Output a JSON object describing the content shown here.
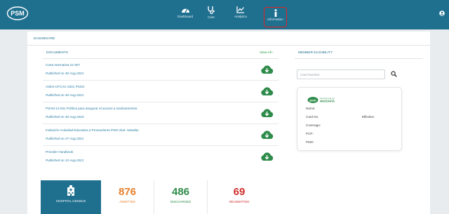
{
  "header": {
    "logo_text": "PSM",
    "logo_subtext": "",
    "nav": [
      {
        "label": "Dashboard",
        "icon": "gauge-icon"
      },
      {
        "label": "Care",
        "icon": "stethoscope-icon"
      },
      {
        "label": "Analytics",
        "icon": "line-chart-icon"
      },
      {
        "label": "Information",
        "icon": "info-icon",
        "highlighted": true
      }
    ]
  },
  "dashboard": {
    "title": "DASHBOARD"
  },
  "documents": {
    "title": "DOCUMENTS",
    "view_all": "View All",
    "items": [
      {
        "title": "Carta Normativa 21-007",
        "date": "Published on 30-Aug-2021"
      },
      {
        "title": "ASES-CFCAC-2021 PSSO",
        "date": "Published on 30-Aug-2021"
      },
      {
        "title": "PSAM 21-031 Política para asegurar el acceso a medicamentos",
        "date": "Published on 30-Aug-2020"
      },
      {
        "title": "Invitación Actividad Educativa a Proveedores PSM Vital- Salud&c",
        "date": "Published on 27-Aug-2021"
      },
      {
        "title": "Provider Handbook",
        "date": "Published on 13-Aug-2021"
      }
    ]
  },
  "member_eligibility": {
    "title": "MEMBER ELIGIBILITY",
    "search_placeholder": "Card Number",
    "card": {
      "logo_text": "PLAN DE SALUD MENONITA",
      "fields": [
        "Name:",
        "Card No.",
        "Coverage:",
        "PCP:",
        "PMG:"
      ],
      "status": "Effective:"
    }
  },
  "stats": {
    "census_label": "HOSPITAL CENSUS",
    "admitted": {
      "value": "876",
      "label": "ADMITTED",
      "color": "#e8802c"
    },
    "discharged": {
      "value": "486",
      "label": "DISCHARGED",
      "color": "#2e8b4a"
    },
    "readmitted": {
      "value": "69",
      "label": "READMITTED",
      "color": "#d0312d"
    }
  },
  "colors": {
    "primary": "#1f6f8f",
    "accent_green": "#2e8b4a",
    "highlight_border": "#dd2222"
  }
}
